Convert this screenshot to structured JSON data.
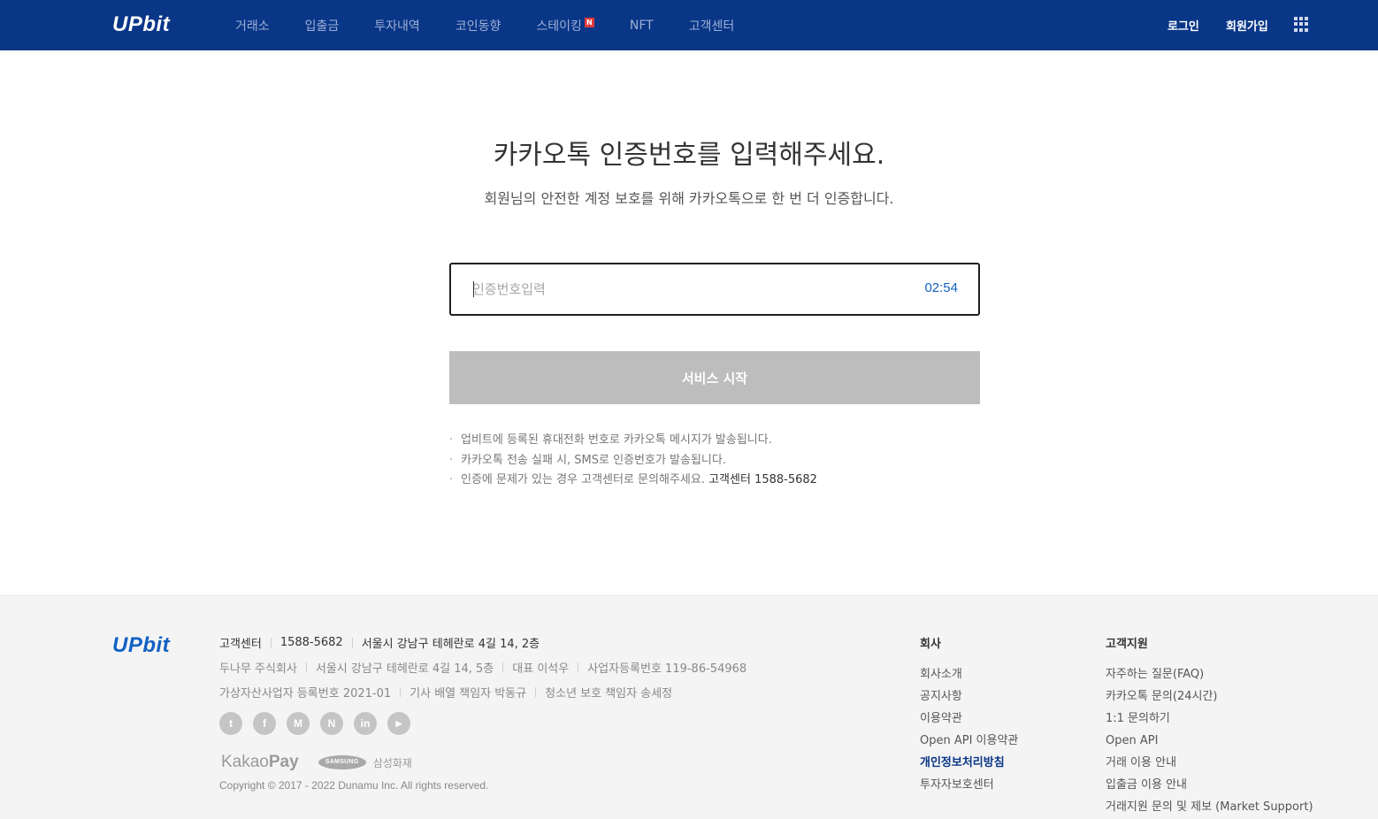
{
  "header": {
    "logo": "UPbit",
    "nav": [
      {
        "label": "거래소"
      },
      {
        "label": "입출금"
      },
      {
        "label": "투자내역"
      },
      {
        "label": "코인동향"
      },
      {
        "label": "스테이킹",
        "badge": "N"
      },
      {
        "label": "NFT"
      },
      {
        "label": "고객센터"
      }
    ],
    "login": "로그인",
    "signup": "회원가입",
    "menu_icon": "grid-icon"
  },
  "main": {
    "title": "카카오톡 인증번호를 입력해주세요.",
    "subtitle": "회원님의 안전한 계정 보호를 위해 카카오톡으로 한 번 더 인증합니다.",
    "code_input": {
      "placeholder": "인증번호입력",
      "value": ""
    },
    "timer": "02:54",
    "start_button": "서비스 시작",
    "notes": [
      {
        "text": "업비트에 등록된 휴대전화 번호로 카카오톡 메시지가 발송됩니다."
      },
      {
        "text": "카카오톡 전송 실패 시, SMS로 인증번호가 발송됩니다."
      },
      {
        "text": "인증에 문제가 있는 경우 고객센터로 문의해주세요. ",
        "strong": "고객센터 1588-5682"
      }
    ],
    "bullet": "·"
  },
  "footer": {
    "logo": "UPbit",
    "row1": [
      "고객센터",
      "1588-5682",
      "서울시 강남구 테헤란로 4길 14, 2층"
    ],
    "row2": [
      "두나무 주식회사",
      "서울시 강남구 테헤란로 4길 14, 5층",
      "대표 이석우",
      "사업자등록번호 119-86-54968"
    ],
    "row3": [
      "가상자산사업자 등록번호 2021-01",
      "기사 배열 책임자 박동규",
      "청소년 보호 책임자 송세정"
    ],
    "socials": [
      {
        "icon": "twitter-icon",
        "glyph": "t"
      },
      {
        "icon": "facebook-icon",
        "glyph": "f"
      },
      {
        "icon": "medium-icon",
        "glyph": "M"
      },
      {
        "icon": "naver-icon",
        "glyph": "N"
      },
      {
        "icon": "linkedin-icon",
        "glyph": "in"
      },
      {
        "icon": "youtube-icon",
        "glyph": "▶"
      }
    ],
    "partners": {
      "kakao": "Kakao",
      "pay": "Pay",
      "samsung_logo": "SAMSUNG",
      "samsung_text": "삼성화재"
    },
    "copyright": "Copyright © 2017 - 2022 Dunamu Inc. All rights reserved.",
    "company": {
      "heading": "회사",
      "links": [
        "회사소개",
        "공지사항",
        "이용약관",
        "Open API 이용약관",
        "개인정보처리방침",
        "투자자보호센터"
      ]
    },
    "support": {
      "heading": "고객지원",
      "links": [
        "자주하는 질문(FAQ)",
        "카카오톡 문의(24시간)",
        "1:1 문의하기",
        "Open API",
        "거래 이용 안내",
        "입출금 이용 안내",
        "거래지원 문의 및 제보 (Market Support)"
      ]
    }
  }
}
